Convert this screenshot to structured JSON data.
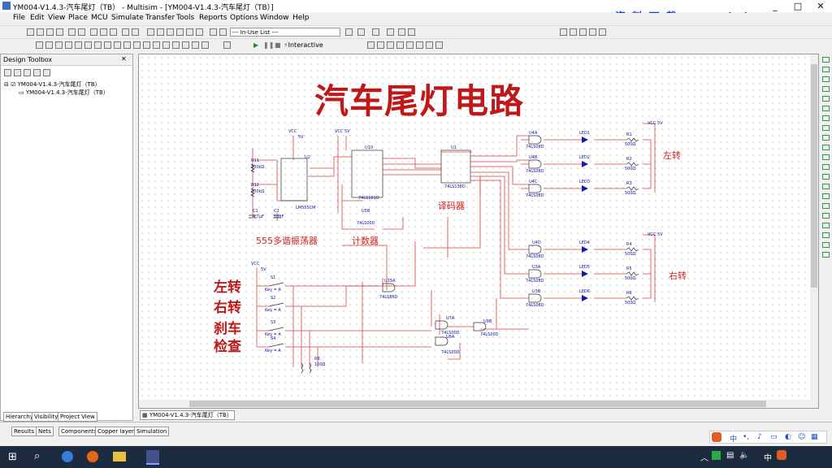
{
  "window": {
    "title": "YM004-V1.4.3-汽车尾灯（TB） - Multisim - [YM004-V1.4.3-汽车尾灯（TB）]",
    "watermark": "资 料 下 载： www.edashare.com",
    "controls": [
      "_",
      "□",
      "✕"
    ]
  },
  "menu": [
    "File",
    "Edit",
    "View",
    "Place",
    "MCU",
    "Simulate",
    "Transfer",
    "Tools",
    "Reports",
    "Options",
    "Window",
    "Help"
  ],
  "toolbar": {
    "in_use_list": "--- In-Use List ---",
    "interactive_label": "Interactive"
  },
  "toolbox": {
    "title": "Design Toolbox",
    "root": "YM004-V1.4.3-汽车尾灯（TB）",
    "child": "YM004-V1.4.3-汽车尾灯（TB）",
    "tabs": [
      "Hierarchy",
      "Visibility",
      "Project View"
    ]
  },
  "document_tab": "YM004-V1.4.3-汽车尾灯（TB）",
  "bottom_tabs": [
    "Results",
    "Nets",
    "Components",
    "Copper layers",
    "Simulation"
  ],
  "schematic": {
    "title": "汽车尾灯电路",
    "oscillator_label": "555多谐振荡器",
    "counter_label": "计数器",
    "decoder_label": "译码器",
    "left_label": "左转",
    "right_label": "右转",
    "inputs": [
      "左转",
      "右转",
      "刹车",
      "检查"
    ],
    "parts": {
      "u2": "U2",
      "u2_type": "LM555CM",
      "u10": "U10",
      "u10_type": "74LS161D",
      "u1": "U1",
      "u1_type": "74LS138D",
      "u5b": "U5B",
      "u5b_type": "74LS00D",
      "u15a": "U15A",
      "u15a_type": "74LS86D",
      "u7a": "U7A",
      "u7a_type": "74LS00D",
      "u8a": "U8A",
      "u8a_type": "74LS00D",
      "u9b": "U9B",
      "u9b_type": "74LS00D",
      "r11": "R11",
      "r12": "R12",
      "r_val1": "100kΩ",
      "r_val2": "100kΩ",
      "c1": "C1",
      "c1_val": "4.7µF",
      "c2": "C2",
      "c2_val": "10nF",
      "r8": "R8",
      "r8_val": "100Ω",
      "vcc": "VCC",
      "vcc5": "5V",
      "vcc_5v": "VCC 5V"
    },
    "gates_left": [
      "U4A",
      "U4B",
      "U4C"
    ],
    "gates_right": [
      "U4D",
      "U3A",
      "U3B"
    ],
    "gate_type": "74LS08D",
    "leds_left": [
      "LED1",
      "LED2",
      "LED3"
    ],
    "leds_right": [
      "LED4",
      "LED5",
      "LED6"
    ],
    "res_left": [
      "R1",
      "R2",
      "R3"
    ],
    "res_right": [
      "R4",
      "R5",
      "R6"
    ],
    "res_value": "500Ω",
    "switches": [
      "S1",
      "S2",
      "S3",
      "S4"
    ],
    "switch_key": "Key = A"
  },
  "taskbar": {
    "ime": "中",
    "tray_text": "中"
  }
}
